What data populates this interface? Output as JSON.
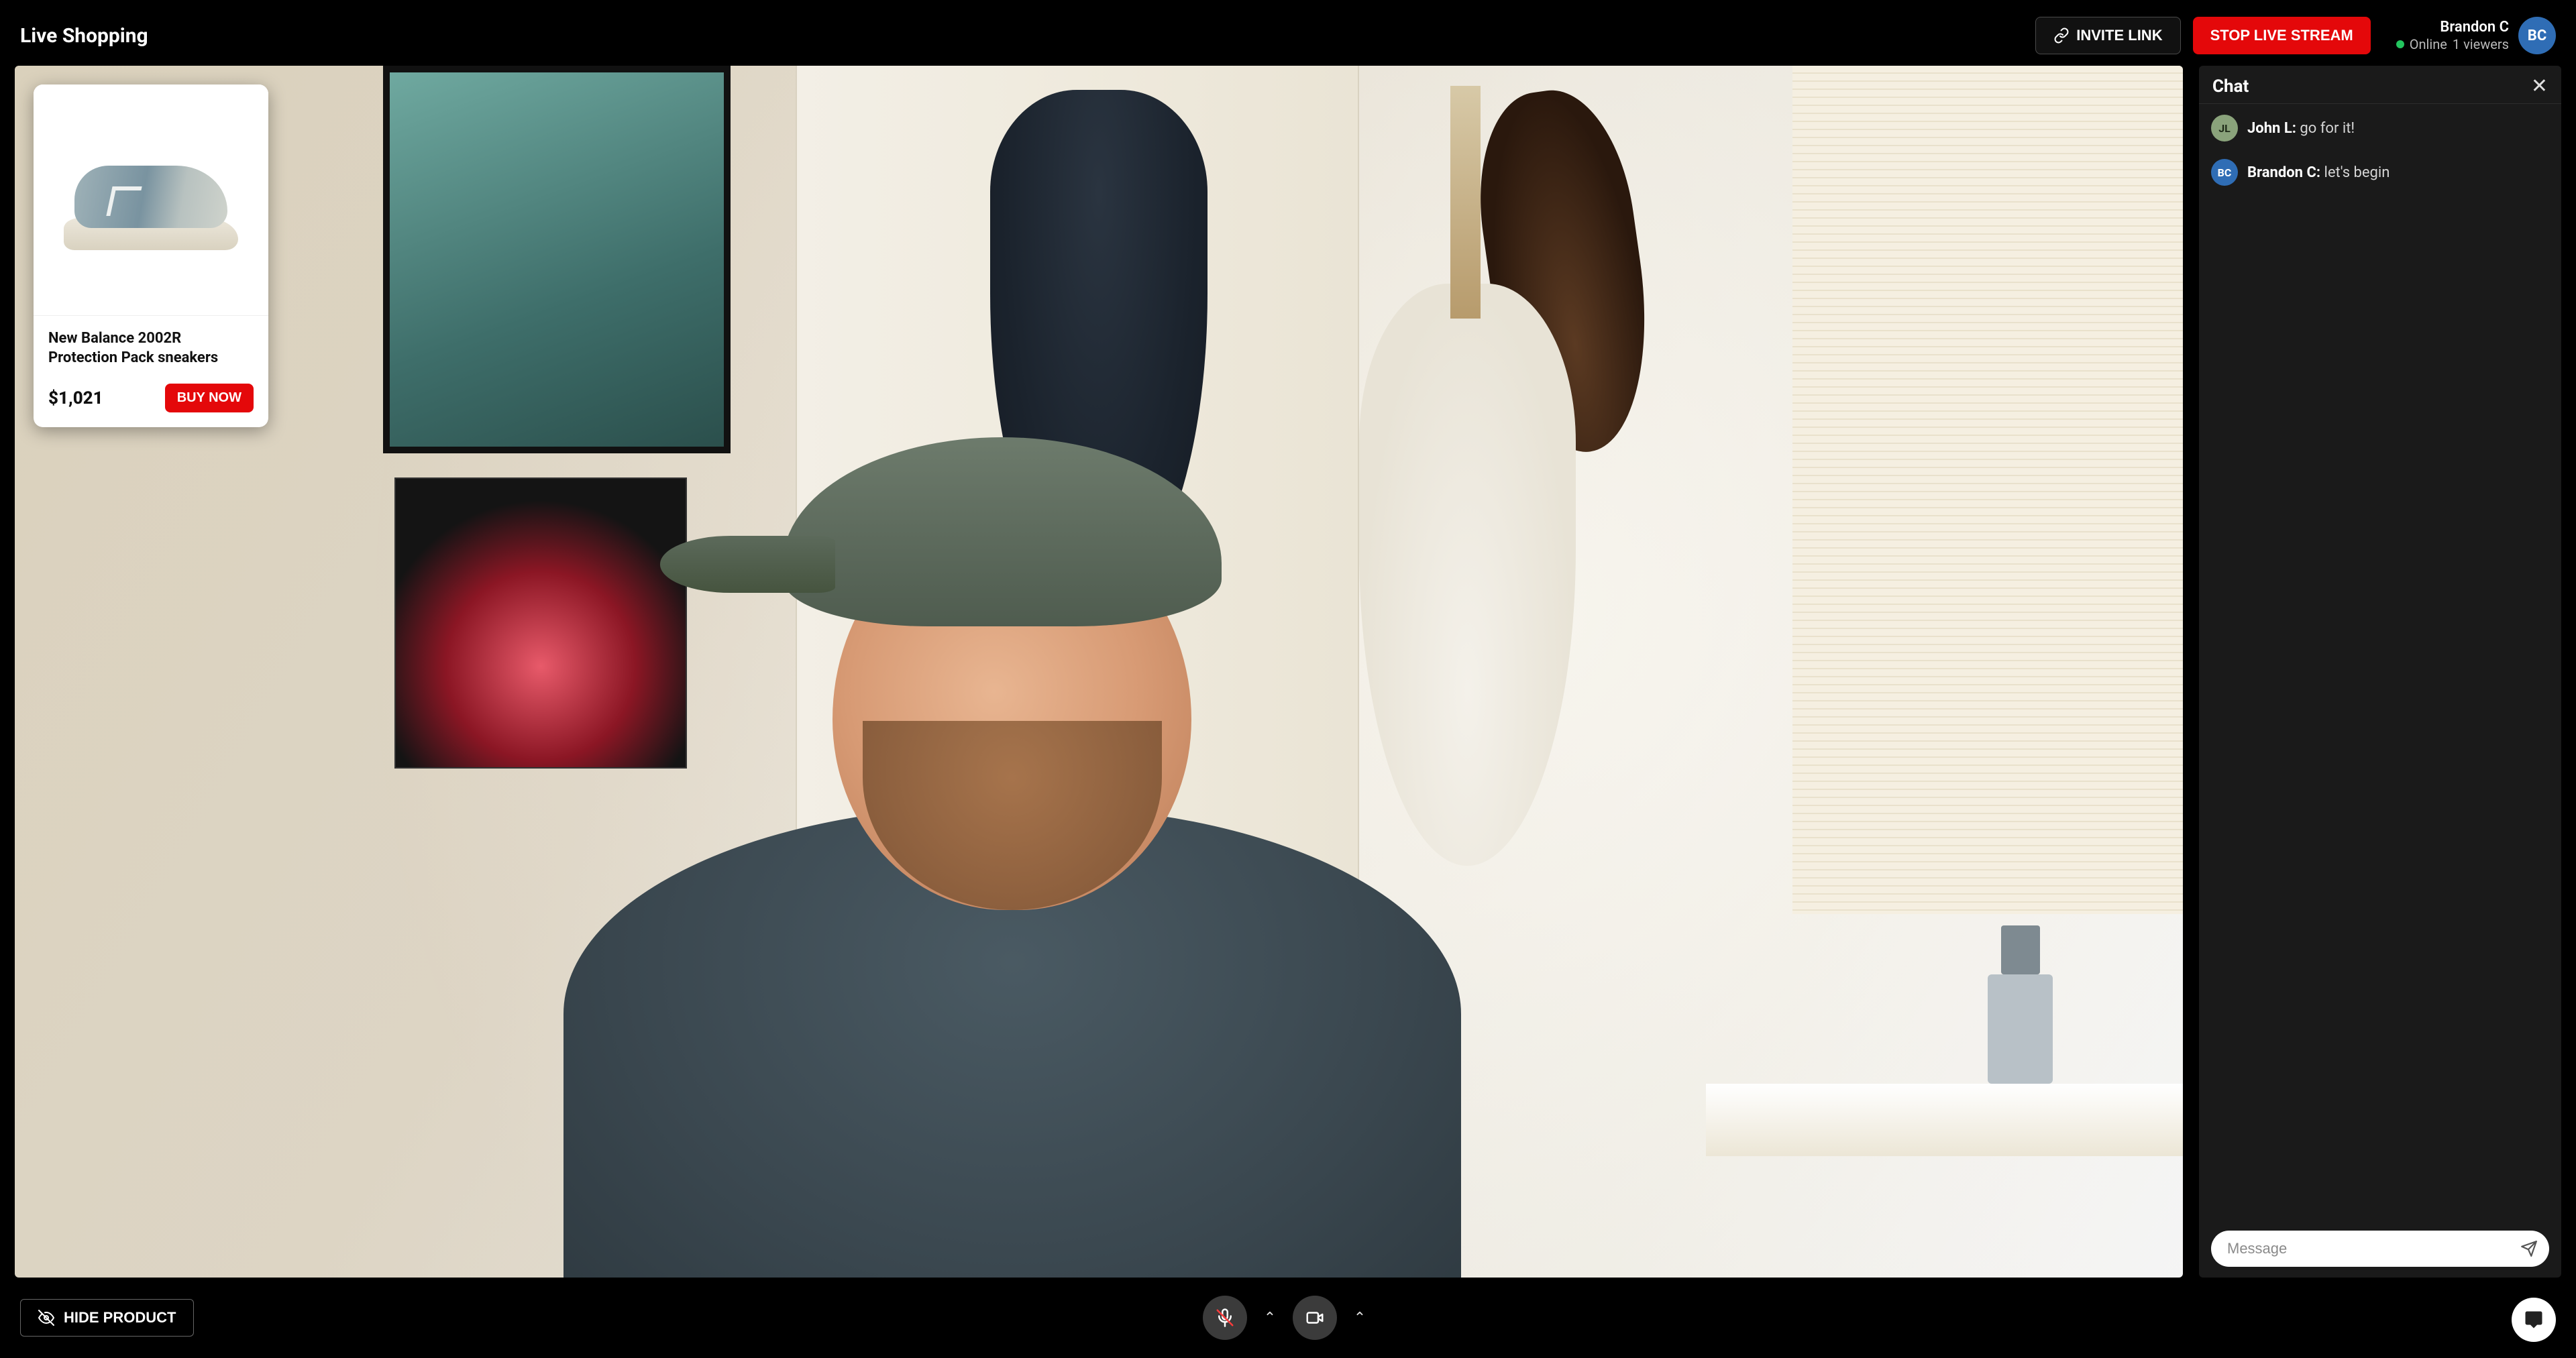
{
  "header": {
    "title": "Live Shopping",
    "invite_label": "INVITE LINK",
    "stop_label": "STOP LIVE STREAM",
    "user": {
      "name": "Brandon C",
      "status": "Online",
      "viewers": "1 viewers",
      "initials": "BC"
    }
  },
  "product": {
    "name": "New Balance 2002R Protection Pack sneakers",
    "price": "$1,021",
    "buy_label": "BUY NOW"
  },
  "chat": {
    "title": "Chat",
    "input_placeholder": "Message",
    "messages": [
      {
        "initials": "JL",
        "author": "John L",
        "author_colon": "John L: ",
        "text": "go for it!",
        "avatar_style": "background:#8aa37b;color:#1e2a18"
      },
      {
        "initials": "BC",
        "author": "Brandon C",
        "author_colon": "Brandon C: ",
        "text": "let's begin",
        "avatar_style": "background:#2f6db5;color:#fff"
      }
    ]
  },
  "controls": {
    "hide_product_label": "HIDE PRODUCT"
  },
  "colors": {
    "danger": "#e4080a",
    "online": "#22c55e",
    "avatar_blue": "#2f6db5"
  }
}
